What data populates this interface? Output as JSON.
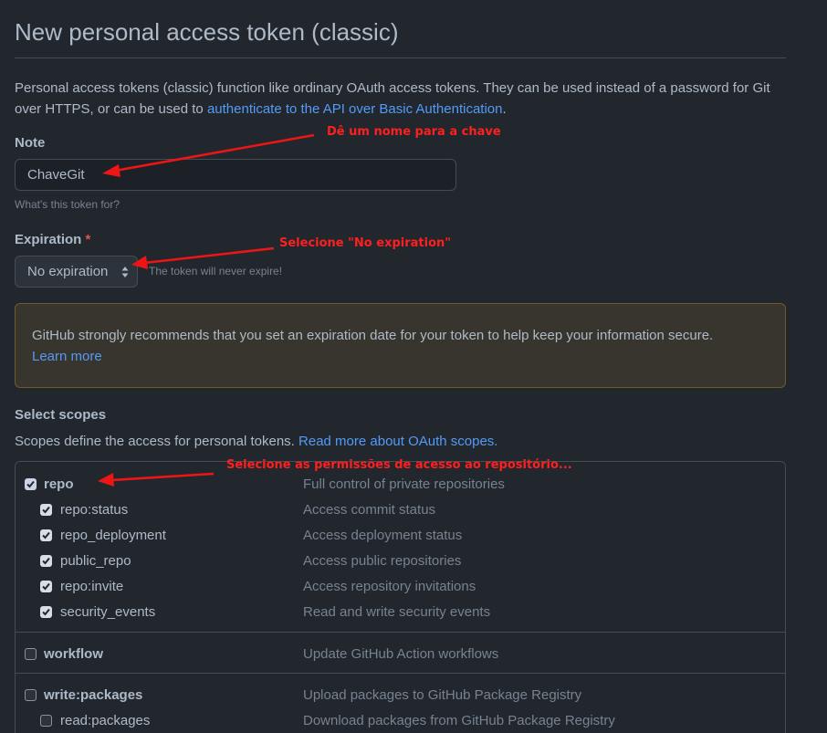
{
  "page": {
    "title": "New personal access token (classic)",
    "intro_text": "Personal access tokens (classic) function like ordinary OAuth access tokens. They can be used instead of a password for Git over HTTPS, or can be used to ",
    "intro_link": "authenticate to the API over Basic Authentication",
    "intro_end": "."
  },
  "note": {
    "label": "Note",
    "value": "ChaveGit",
    "hint": "What's this token for?"
  },
  "expiration": {
    "label": "Expiration",
    "required_mark": "*",
    "selected": "No expiration",
    "hint": "The token will never expire!"
  },
  "flash": {
    "text": "GitHub strongly recommends that you set an expiration date for your token to help keep your information secure.",
    "link": "Learn more"
  },
  "scopes": {
    "label": "Select scopes",
    "intro": "Scopes define the access for personal tokens. ",
    "intro_link": "Read more about OAuth scopes.",
    "items": [
      {
        "name": "repo",
        "desc": "Full control of private repositories",
        "checked": true
      },
      {
        "name": "repo:status",
        "desc": "Access commit status",
        "checked": true
      },
      {
        "name": "repo_deployment",
        "desc": "Access deployment status",
        "checked": true
      },
      {
        "name": "public_repo",
        "desc": "Access public repositories",
        "checked": true
      },
      {
        "name": "repo:invite",
        "desc": "Access repository invitations",
        "checked": true
      },
      {
        "name": "security_events",
        "desc": "Read and write security events",
        "checked": true
      },
      {
        "name": "workflow",
        "desc": "Update GitHub Action workflows",
        "checked": false
      },
      {
        "name": "write:packages",
        "desc": "Upload packages to GitHub Package Registry",
        "checked": false
      },
      {
        "name": "read:packages",
        "desc": "Download packages from GitHub Package Registry",
        "checked": false
      }
    ]
  },
  "annotations": {
    "note": "Dê um nome para a chave",
    "expiration": "Selecione \"No expiration\"",
    "scopes": "Selecione as permissões de acesso ao repositório..."
  },
  "colors": {
    "background": "#22272e",
    "link": "#539bf5",
    "annotation": "#ff1f1f",
    "flash_bg": "#38352e"
  }
}
